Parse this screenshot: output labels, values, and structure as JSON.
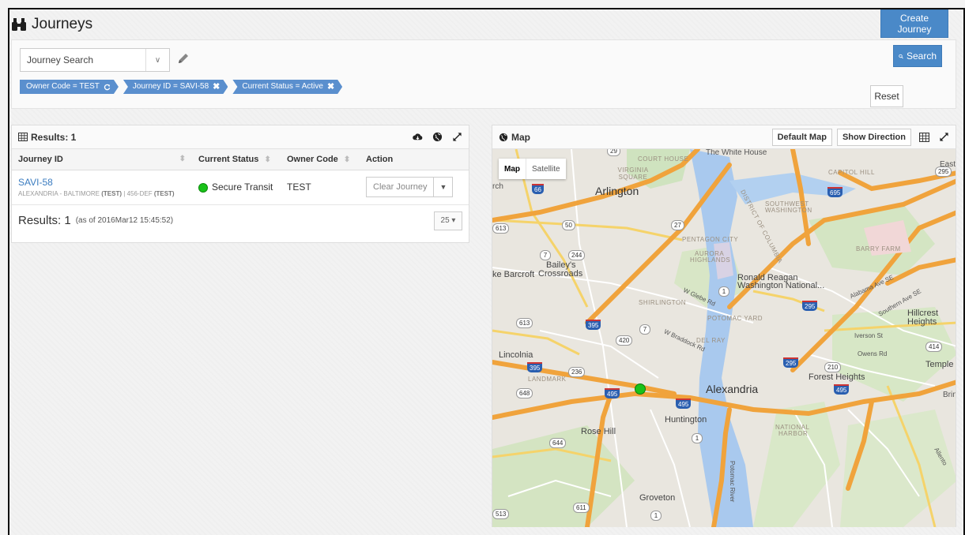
{
  "header": {
    "title": "Journeys",
    "create_label": "Create Journey"
  },
  "search": {
    "select_value": "Journey Search",
    "chips": [
      {
        "label": "Owner Code = TEST",
        "icon": "refresh-icon"
      },
      {
        "label": "Journey ID = SAVI-58",
        "icon": "close-icon"
      },
      {
        "label": "Current Status = Active",
        "icon": "close-icon"
      }
    ],
    "reset_label": "Reset",
    "search_label": "Search"
  },
  "results": {
    "title": "Results: 1",
    "columns": [
      "Journey ID",
      "Current Status",
      "Owner Code",
      "Action"
    ],
    "rows": [
      {
        "journey_id": "SAVI-58",
        "route": "ALEXANDRIA - BALTIMORE",
        "route_code": "(TEST)",
        "sep": "|",
        "asset": "456-DEF",
        "asset_code": "(TEST)",
        "status": "Secure Transit",
        "status_color": "#19c219",
        "owner_code": "TEST",
        "action_label": "Clear Journey"
      }
    ],
    "footer_label": "Results: 1",
    "footer_asof": "(as of 2016Mar12 15:45:52)",
    "page_size": "25 ▾"
  },
  "map": {
    "title": "Map",
    "default_map_label": "Default Map",
    "show_direction_label": "Show Direction",
    "type_map": "Map",
    "type_satellite": "Satellite",
    "labels": {
      "arlington": "Arlington",
      "alexandria": "Alexandria",
      "white_house": "The White House",
      "baileys": "Bailey's",
      "crossroads": "Crossroads",
      "barcroft": "ke Barcroft",
      "lincolnia": "Lincolnia",
      "rose_hill": "Rose Hill",
      "huntington": "Huntington",
      "groveton": "Groveton",
      "ronald_reagan": "Ronald Reagan",
      "washington_national": "Washington National...",
      "hillcrest": "Hillcrest",
      "heights": "Heights",
      "forest_heights": "Forest Heights",
      "temple": "Temple",
      "capitol_hill": "CAPITOL HILL",
      "pentagon_city": "PENTAGON CITY",
      "aurora": "AURORA",
      "highlands": "HIGHLANDS",
      "shirlington": "SHIRLINGTON",
      "potomac_yard": "POTOMAC YARD",
      "del_ray": "DEL RAY",
      "landmark": "LANDMARK",
      "national": "NATIONAL",
      "harbor": "HARBOR",
      "barry_farm": "BARRY FARM",
      "southwest": "SOUTHWEST",
      "washington": "WASHINGTON",
      "courthouse": "COURT HOUSE",
      "potomac_river": "Potomac River",
      "district": "DISTRICT OF COLUMBIA",
      "east": "East",
      "rch": "rch",
      "virginia_square": "VIRGINIA SQUARE",
      "w_glebe": "W Glebe Rd",
      "w_braddock": "W Braddock Rd",
      "iverson": "Iverson St",
      "owens": "Owens Rd",
      "alabama": "Alabama Ave SE",
      "southern": "Southern Ave SE",
      "brink": "Brink",
      "allento": "Allento"
    },
    "shields": {
      "i66": "66",
      "i395a": "395",
      "i395b": "395",
      "i495a": "495",
      "i495b": "495",
      "i495c": "495",
      "i295a": "295",
      "i295b": "295",
      "i695": "695",
      "r50": "50",
      "r27": "27",
      "r7a": "7",
      "r7b": "7",
      "r244": "244",
      "r613a": "613",
      "r613b": "613",
      "r420": "420",
      "r236": "236",
      "r648": "648",
      "r644": "644",
      "r611": "611",
      "r1a": "1",
      "r1b": "1",
      "r1c": "1",
      "r210": "210",
      "r414": "414",
      "r295top": "295",
      "r29": "29",
      "r513": "513"
    }
  }
}
